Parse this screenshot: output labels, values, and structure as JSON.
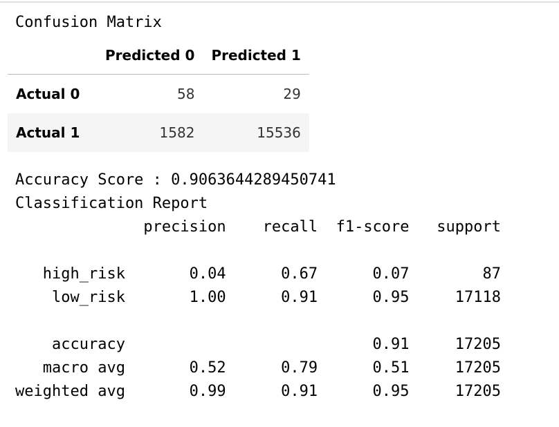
{
  "confusion_title": "Confusion Matrix",
  "matrix": {
    "corner": "",
    "columns": [
      "Predicted 0",
      "Predicted 1"
    ],
    "rows": [
      {
        "label": "Actual 0",
        "values": [
          "58",
          "29"
        ]
      },
      {
        "label": "Actual 1",
        "values": [
          "1582",
          "15536"
        ]
      }
    ]
  },
  "accuracy_line": "Accuracy Score : 0.9063644289450741",
  "report_title": "Classification Report",
  "report_lines": [
    "              precision    recall  f1-score   support",
    "",
    "   high_risk       0.04      0.67      0.07        87",
    "    low_risk       1.00      0.91      0.95     17118",
    "",
    "    accuracy                           0.91     17205",
    "   macro avg       0.52      0.79      0.51     17205",
    "weighted avg       0.99      0.91      0.95     17205"
  ]
}
